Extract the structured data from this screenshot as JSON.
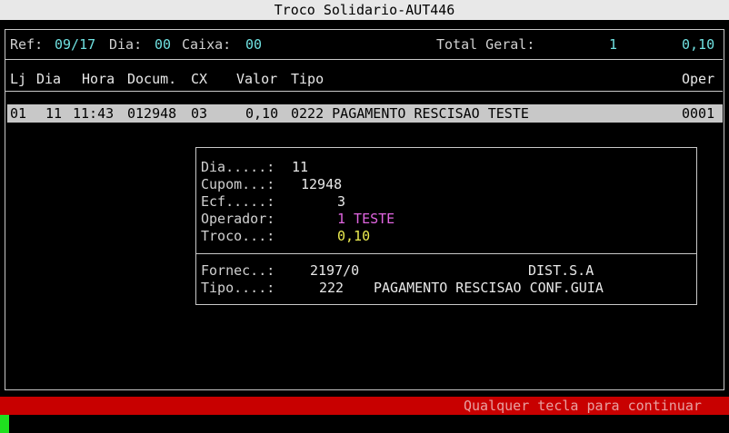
{
  "window": {
    "title": "Troco Solidario-AUT446"
  },
  "header": {
    "ref_label": "Ref:",
    "ref_value": "09/17",
    "dia_label": "Dia:",
    "dia_value": "00",
    "caixa_label": "Caixa:",
    "caixa_value": "00",
    "total_label": "Total Geral:",
    "total_count": "1",
    "total_value": "0,10"
  },
  "table": {
    "columns": [
      "Lj",
      "Dia",
      "Hora",
      "Docum.",
      "CX",
      "Valor",
      "Tipo",
      "Oper"
    ],
    "rows": [
      {
        "lj": "01",
        "dia": "11",
        "hora": "11:43",
        "docum": "012948",
        "cx": "03",
        "valor": "0,10",
        "tipo": "0222 PAGAMENTO RESCISAO TESTE",
        "oper": "0001"
      }
    ]
  },
  "detail": {
    "dia_label": "Dia.....:",
    "dia_value": "11",
    "cupom_label": "Cupom...:",
    "cupom_value": "12948",
    "ecf_label": "Ecf.....:",
    "ecf_value": "3",
    "operador_label": "Operador:",
    "operador_value": "1 TESTE",
    "troco_label": "Troco...:",
    "troco_value": "0,10",
    "fornec_label": "Fornec..:",
    "fornec_code": "2197/0",
    "fornec_name": "DIST.S.A",
    "tipo_label": "Tipo....:",
    "tipo_code": "222",
    "tipo_desc": "PAGAMENTO RESCISAO CONF.GUIA"
  },
  "status": {
    "message": "Qualquer tecla para continuar"
  },
  "colors": {
    "cyan": "#6fe0e0",
    "magenta": "#e065e0",
    "yellow": "#ecec50",
    "status_bg": "#c80000",
    "cursor": "#1fe01f"
  }
}
